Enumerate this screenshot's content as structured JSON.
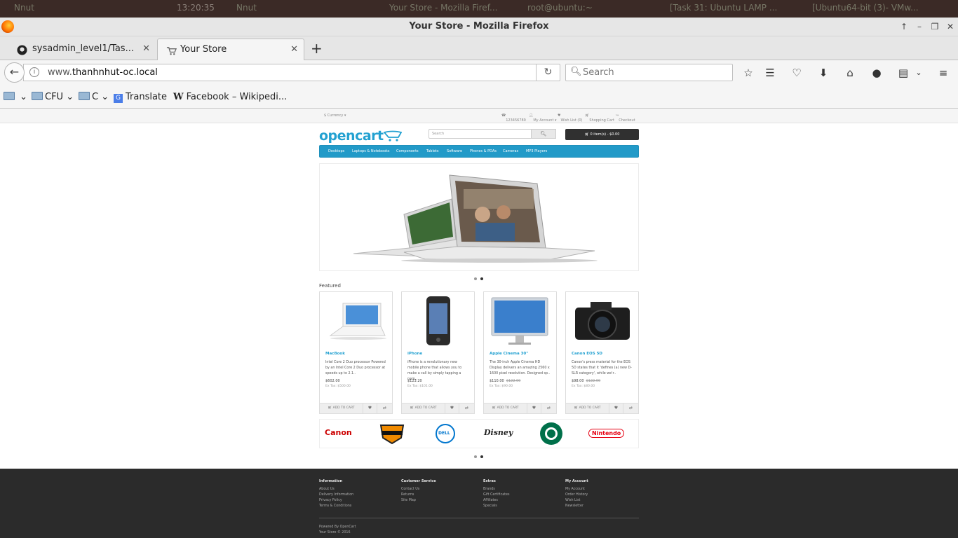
{
  "desktop_panel": {
    "items": [
      "Nnut",
      "13:20:35",
      "Nnut",
      "Your Store - Mozilla Firef...",
      "root@ubuntu:~",
      "[Task 31: Ubuntu LAMP ...",
      "[Ubuntu64-bit (3)- VMw..."
    ]
  },
  "window": {
    "title": "Your Store - Mozilla Firefox"
  },
  "tabs": [
    {
      "label": "sysadmin_level1/Tas..."
    },
    {
      "label": "Your Store"
    }
  ],
  "urlbar": {
    "prefix": "www.",
    "domain": "thanhnhut-oc.local"
  },
  "search": {
    "placeholder": "Search"
  },
  "bookmarks": [
    {
      "label": ""
    },
    {
      "label": "CFU"
    },
    {
      "label": "C"
    },
    {
      "label": "Translate"
    },
    {
      "label": "Facebook – Wikipedi..."
    }
  ],
  "store": {
    "top_links": {
      "currency": "$ Currency ▾",
      "phone": "123456789",
      "account": "My Account ▾",
      "wishlist": "Wish List (0)",
      "cart": "Shopping Cart",
      "checkout": "Checkout"
    },
    "logo": "opencart",
    "search_placeholder": "Search",
    "cart_button": "0 item(s) - $0.00",
    "menu": [
      "Desktops",
      "Laptops & Notebooks",
      "Components",
      "Tablets",
      "Software",
      "Phones & PDAs",
      "Cameras",
      "MP3 Players"
    ],
    "featured_title": "Featured",
    "products": [
      {
        "name": "MacBook",
        "desc": "Intel Core 2 Duo processor Powered by an Intel Core 2 Duo processor at speeds up to 2.1..",
        "price": "$602.00",
        "old_price": "",
        "extax": "Ex Tax: $500.00"
      },
      {
        "name": "iPhone",
        "desc": "iPhone is a revolutionary new mobile phone that allows you to make a call by simply tapping a nam..",
        "price": "$123.20",
        "old_price": "",
        "extax": "Ex Tax: $101.00"
      },
      {
        "name": "Apple Cinema 30\"",
        "desc": "The 30-inch Apple Cinema HD Display delivers an amazing 2560 x 1600 pixel resolution. Designed sp..",
        "price": "$110.00",
        "old_price": "$122.00",
        "extax": "Ex Tax: $90.00"
      },
      {
        "name": "Canon EOS 5D",
        "desc": "Canon's press material for the EOS 5D states that it 'defines (a) new D-SLR category', while we'r..",
        "price": "$98.00",
        "old_price": "$122.00",
        "extax": "Ex Tax: $80.00"
      }
    ],
    "add_to_cart": "ADD TO CART",
    "brands": [
      "Canon",
      "Harley-Davidson",
      "DELL",
      "Disney",
      "Starbucks",
      "Nintendo"
    ],
    "footer": {
      "columns": [
        {
          "title": "Information",
          "links": [
            "About Us",
            "Delivery Information",
            "Privacy Policy",
            "Terms & Conditions"
          ]
        },
        {
          "title": "Customer Service",
          "links": [
            "Contact Us",
            "Returns",
            "Site Map"
          ]
        },
        {
          "title": "Extras",
          "links": [
            "Brands",
            "Gift Certificates",
            "Affiliates",
            "Specials"
          ]
        },
        {
          "title": "My Account",
          "links": [
            "My Account",
            "Order History",
            "Wish List",
            "Newsletter"
          ]
        }
      ],
      "powered": "Powered By OpenCart",
      "copyright": "Your Store © 2016"
    }
  },
  "colors": {
    "accent": "#229ac8",
    "link": "#23a1d1",
    "footer_bg": "#2b2b2b",
    "cart_bg": "#303030"
  }
}
